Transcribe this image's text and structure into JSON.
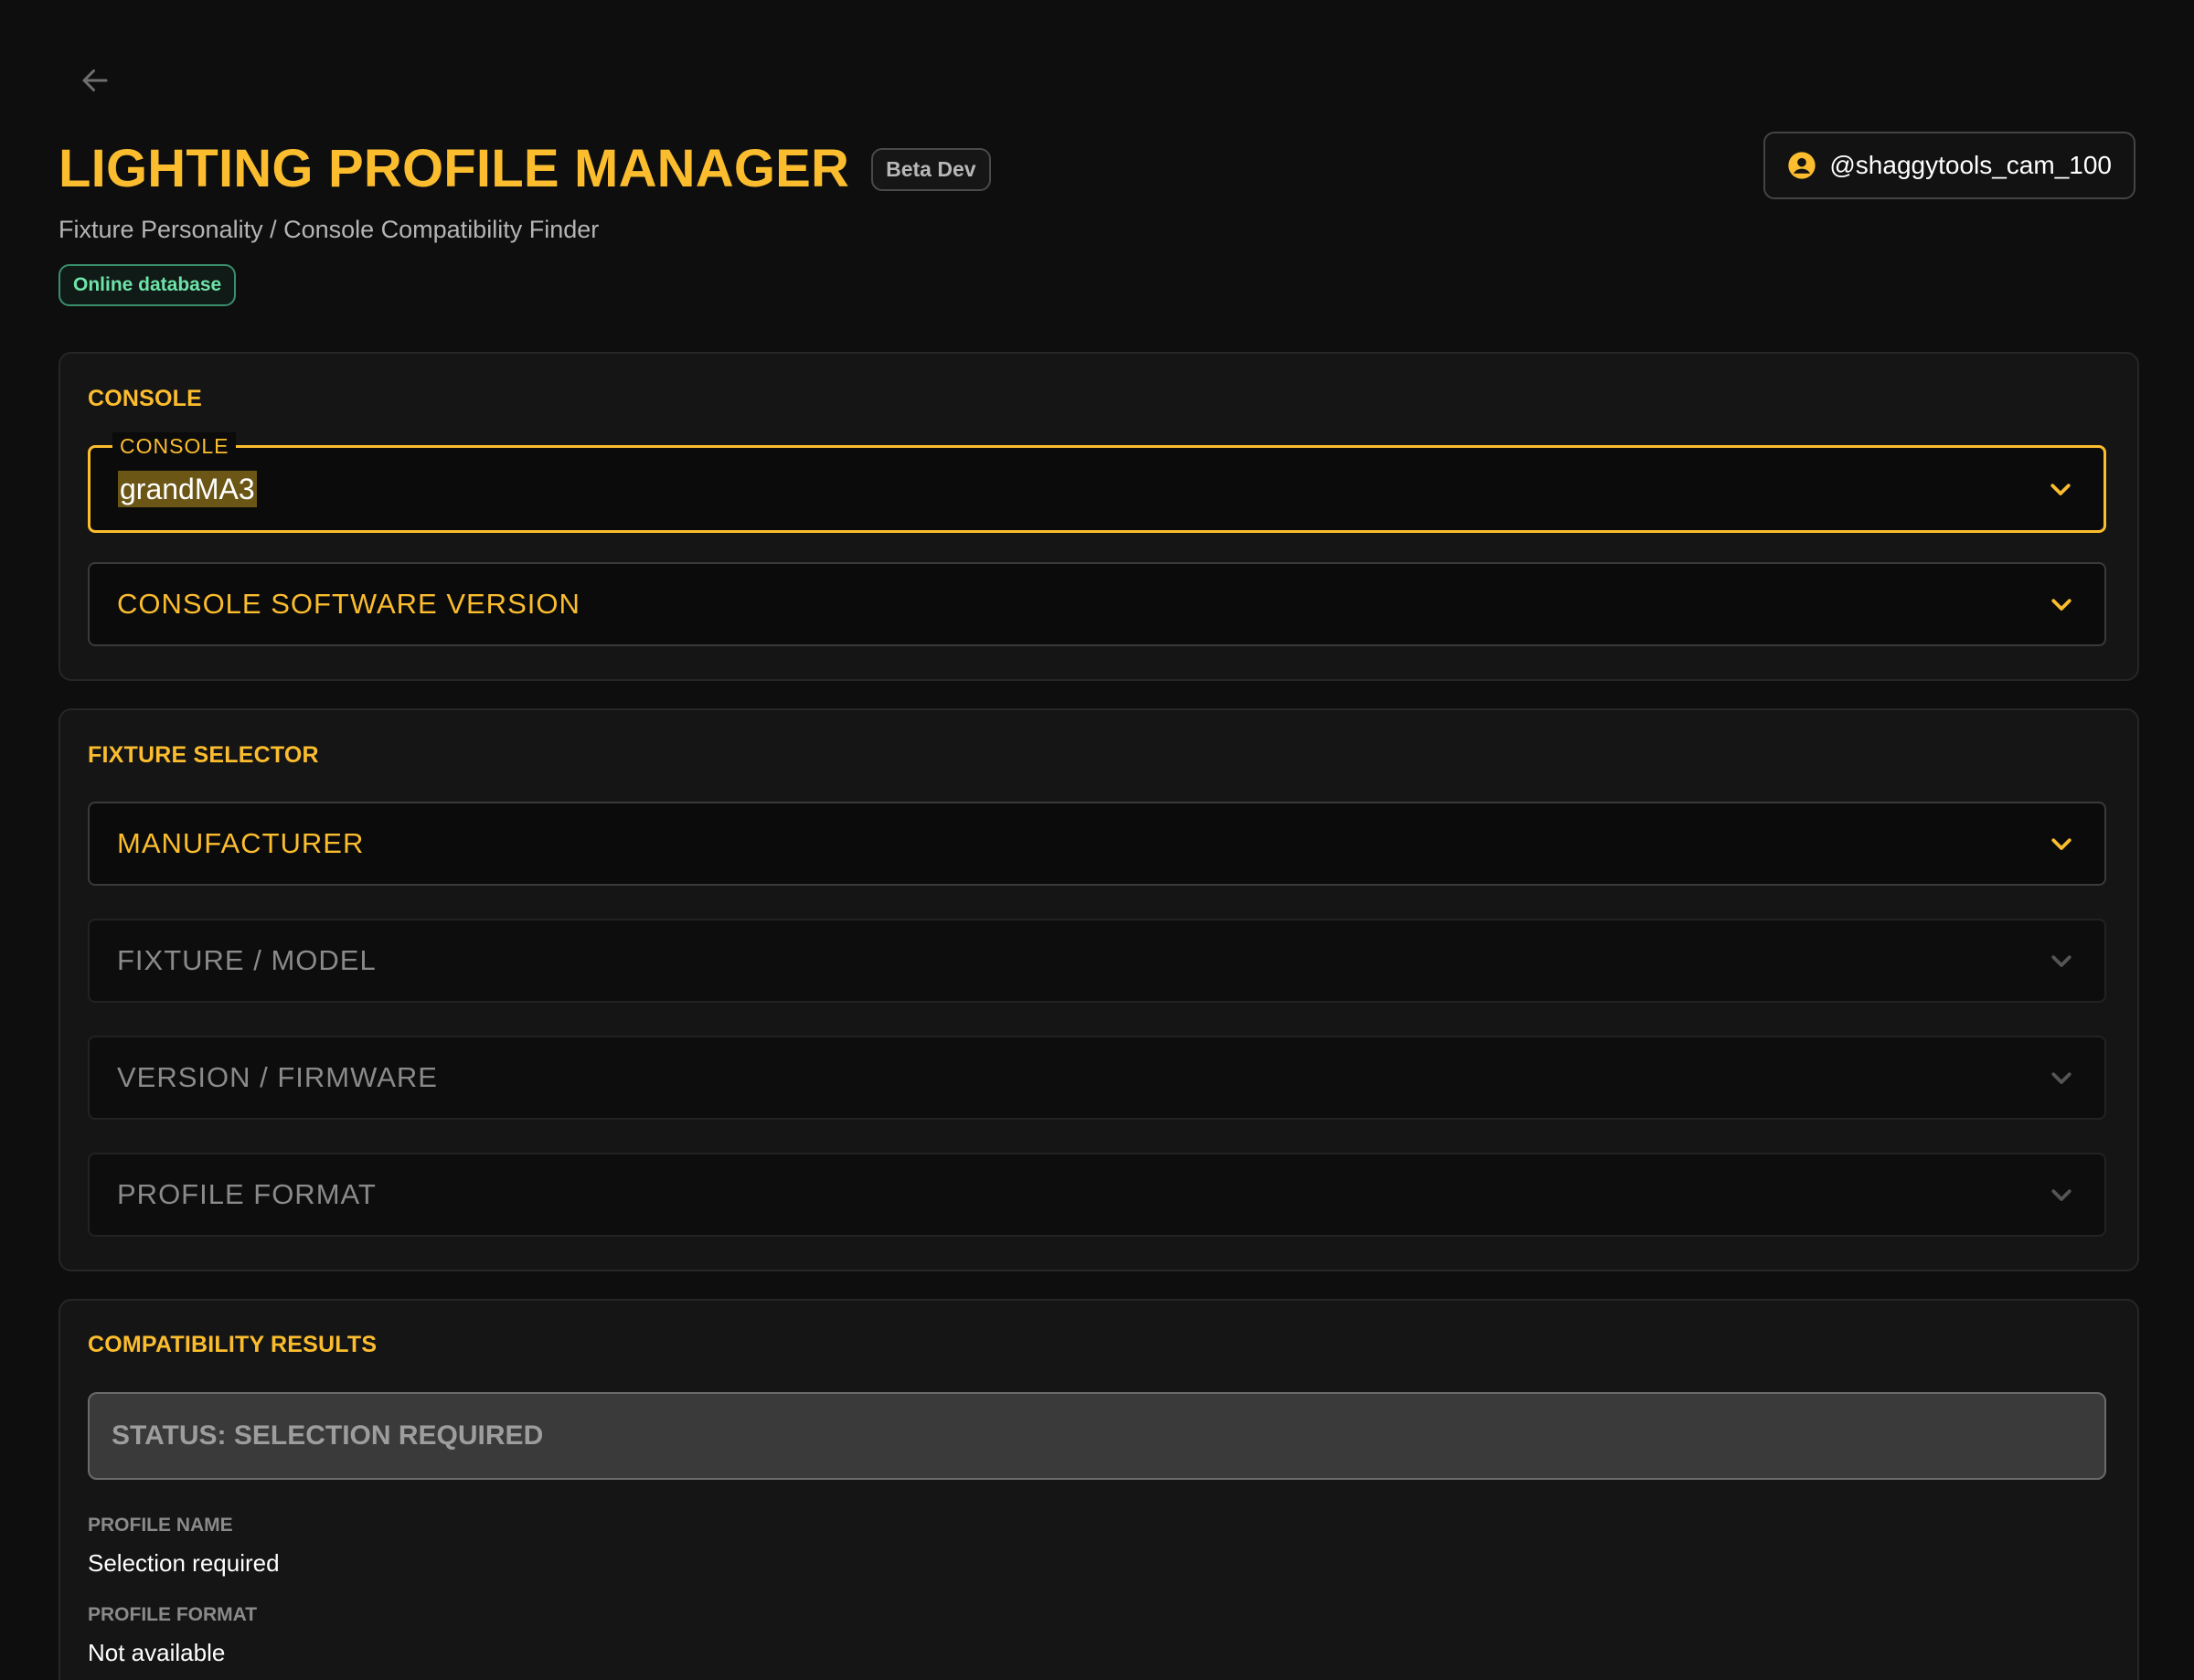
{
  "header": {
    "back_icon": "arrow-left-icon",
    "title": "LIGHTING PROFILE MANAGER",
    "env_badge": "Beta Dev",
    "subtitle": "Fixture Personality / Console Compatibility Finder",
    "db_status": "Online database",
    "user": {
      "icon": "user-circle-icon",
      "handle": "@shaggytools_cam_100"
    }
  },
  "console_card": {
    "title": "CONSOLE",
    "console_field": {
      "label": "CONSOLE",
      "value": "grandMA3"
    },
    "software_version_field": {
      "label": "CONSOLE SOFTWARE VERSION"
    }
  },
  "fixture_card": {
    "title": "FIXTURE SELECTOR",
    "manufacturer_field": {
      "label": "MANUFACTURER"
    },
    "model_field": {
      "label": "FIXTURE / MODEL"
    },
    "firmware_field": {
      "label": "VERSION / FIRMWARE"
    },
    "format_field": {
      "label": "PROFILE FORMAT"
    }
  },
  "results_card": {
    "title": "COMPATIBILITY RESULTS",
    "status": "STATUS: SELECTION REQUIRED",
    "profile_name_label": "PROFILE NAME",
    "profile_name_value": "Selection required",
    "profile_format_label": "PROFILE FORMAT",
    "profile_format_value": "Not available"
  },
  "colors": {
    "accent": "#fbbd2e",
    "background": "#0e0e0e",
    "card": "#151515",
    "online": "#6ee3a9"
  }
}
